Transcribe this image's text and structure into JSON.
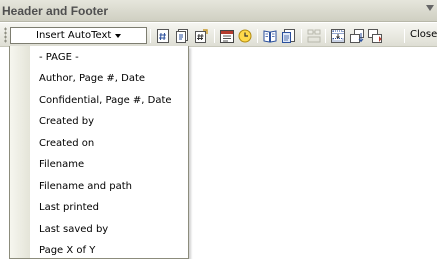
{
  "titlebar": {
    "title": "Header and Footer"
  },
  "toolbar": {
    "autotext_label": "Insert AutoText",
    "close_label": "Close",
    "icons": [
      "insert-page-number-icon",
      "insert-number-of-pages-icon",
      "format-page-number-icon",
      "insert-date-icon",
      "insert-time-icon",
      "page-setup-icon",
      "show-hide-document-text-icon",
      "link-to-previous-icon",
      "switch-header-footer-icon",
      "show-previous-icon",
      "show-next-icon"
    ]
  },
  "menu": {
    "items": [
      {
        "label": "- PAGE -"
      },
      {
        "label": "Author, Page #, Date"
      },
      {
        "label": "Confidential, Page #, Date"
      },
      {
        "label": "Created by"
      },
      {
        "label": "Created on"
      },
      {
        "label": "Filename"
      },
      {
        "label": "Filename and path"
      },
      {
        "label": "Last printed"
      },
      {
        "label": "Last saved by"
      },
      {
        "label": "Page X of Y"
      }
    ]
  }
}
